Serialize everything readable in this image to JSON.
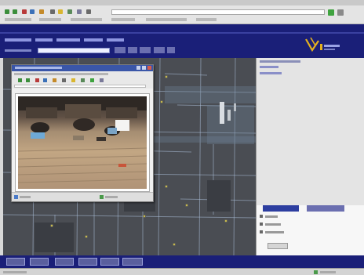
{
  "browser": {
    "toolbar_icons": [
      {
        "name": "back-icon",
        "color": "#3c8e3c"
      },
      {
        "name": "forward-icon",
        "color": "#3c8e3c"
      },
      {
        "name": "stop-icon",
        "color": "#b83a3a"
      },
      {
        "name": "refresh-icon",
        "color": "#3a70b8"
      },
      {
        "name": "home-icon",
        "color": "#c48a2a"
      },
      {
        "name": "search-icon",
        "color": "#6a6a6a"
      },
      {
        "name": "favorites-icon",
        "color": "#d9b630"
      },
      {
        "name": "history-icon",
        "color": "#5a8a5a"
      },
      {
        "name": "mail-icon",
        "color": "#7a7a9a"
      },
      {
        "name": "print-icon",
        "color": "#6a6a6a"
      }
    ],
    "go_icon_color": "#3fa33f"
  },
  "app": {
    "header_color": "#1a1f78",
    "accent_color": "#e0a020",
    "logo_accent": "#e4b11e"
  },
  "layers": {
    "tab_colors": [
      "#2d3ea0",
      "#6b6fb0"
    ]
  },
  "map": {
    "pin_color": "#e6d34a"
  }
}
